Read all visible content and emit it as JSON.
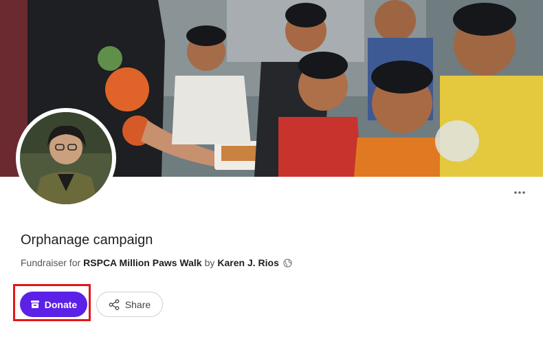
{
  "fundraiser": {
    "title": "Orphanage campaign",
    "prefix": "Fundraiser for",
    "cause": "RSPCA Million Paws Walk",
    "by": "by",
    "organizer": "Karen J. Rios"
  },
  "actions": {
    "donate_label": "Donate",
    "share_label": "Share",
    "more_label": "···"
  },
  "icons": {
    "donate": "donate-box-icon",
    "share": "share-icon",
    "privacy": "globe-icon",
    "more": "more-options-icon"
  },
  "colors": {
    "donate_bg": "#5b21e6",
    "highlight": "#e3151a"
  }
}
